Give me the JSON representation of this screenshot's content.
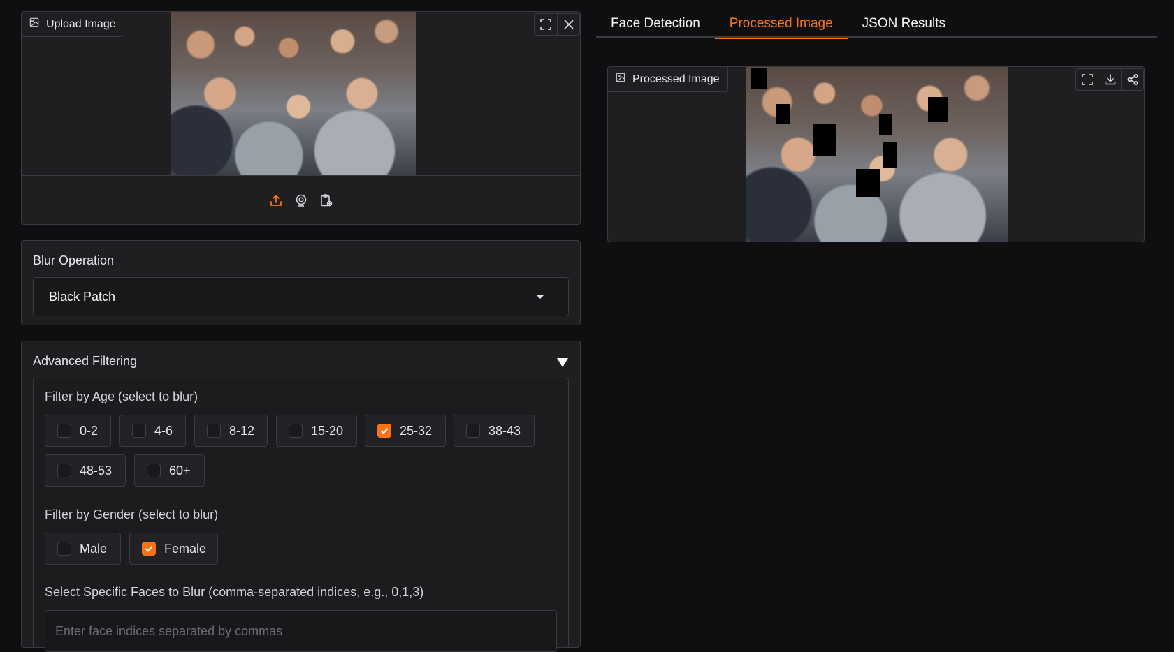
{
  "upload": {
    "label": "Upload Image",
    "icons": [
      "image-icon",
      "fullscreen-icon",
      "close-icon",
      "upload-icon",
      "webcam-icon",
      "clipboard-icon"
    ],
    "accent": "#f97316"
  },
  "blur": {
    "label": "Blur Operation",
    "selected": "Black Patch"
  },
  "advanced": {
    "title": "Advanced Filtering",
    "age_label": "Filter by Age (select to blur)",
    "ages": [
      {
        "label": "0-2",
        "checked": false
      },
      {
        "label": "4-6",
        "checked": false
      },
      {
        "label": "8-12",
        "checked": false
      },
      {
        "label": "15-20",
        "checked": false
      },
      {
        "label": "25-32",
        "checked": true
      },
      {
        "label": "38-43",
        "checked": false
      },
      {
        "label": "48-53",
        "checked": false
      },
      {
        "label": "60+",
        "checked": false
      }
    ],
    "gender_label": "Filter by Gender (select to blur)",
    "genders": [
      {
        "label": "Male",
        "checked": false
      },
      {
        "label": "Female",
        "checked": true
      }
    ],
    "faces_label": "Select Specific Faces to Blur (comma-separated indices, e.g., 0,1,3)",
    "faces_placeholder": "Enter face indices separated by commas"
  },
  "tabs": [
    {
      "label": "Face Detection",
      "active": false
    },
    {
      "label": "Processed Image",
      "active": true
    },
    {
      "label": "JSON Results",
      "active": false
    }
  ],
  "processed": {
    "label": "Processed Image",
    "icons": [
      "image-icon",
      "fullscreen-icon",
      "download-icon",
      "share-icon"
    ]
  },
  "colors": {
    "background": "#0f0f11",
    "panel": "#1f1f22",
    "accent": "#f97316"
  }
}
